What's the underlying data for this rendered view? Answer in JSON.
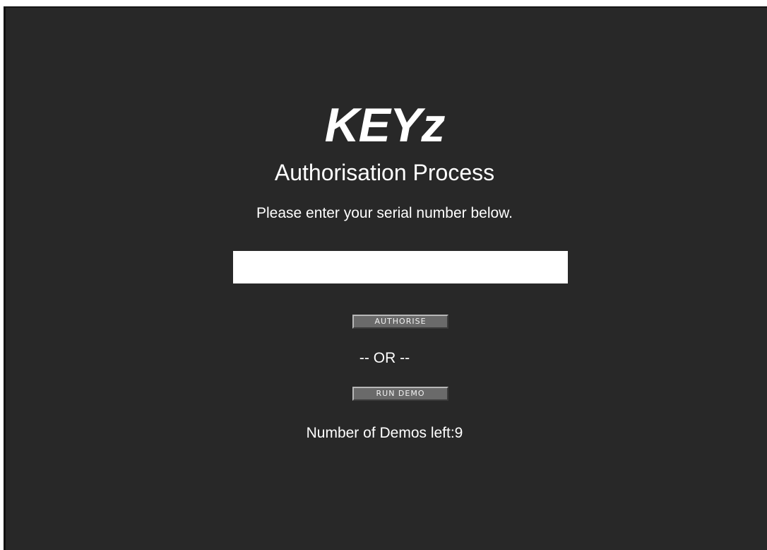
{
  "app": {
    "logo_text": "KEYz",
    "title": "Authorisation Process",
    "prompt": "Please enter your serial number below."
  },
  "serial": {
    "value": "",
    "placeholder": ""
  },
  "actions": {
    "authorise_label": "AUTHORISE",
    "separator": "-- OR --",
    "run_demo_label": "RUN DEMO"
  },
  "demos": {
    "label": "Number of Demos left:",
    "count": "9",
    "text": "Number of Demos left:9"
  },
  "colors": {
    "background": "#282828",
    "text": "#ffffff",
    "button": "#6a6a6a",
    "input": "#ffffff"
  }
}
